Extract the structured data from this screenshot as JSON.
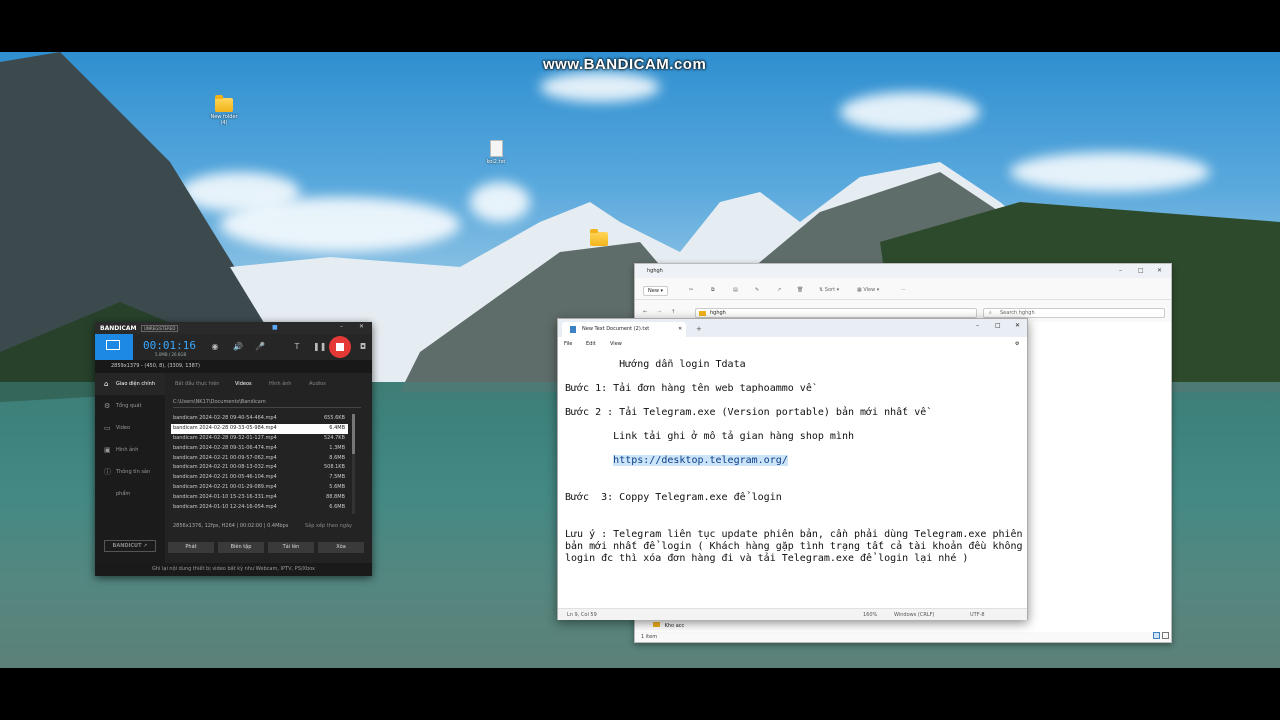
{
  "watermark": "www.BANDICAM.com",
  "desktop_icons": [
    {
      "label": "New folder\n(4)"
    },
    {
      "label": "koi2.txt"
    }
  ],
  "bandicam": {
    "logo": "BANDICAM",
    "unregistered": "UNREGISTERED",
    "timer": "00:01:16",
    "size": "5.0MB / 26.6GB",
    "resolution": "2859x1379 - (450, 8), (3309, 1387)",
    "sidebar": [
      {
        "label": "Giao diện chính",
        "icon": "home-icon"
      },
      {
        "label": "Tổng quát",
        "icon": "gear-icon"
      },
      {
        "label": "Video",
        "icon": "video-icon"
      },
      {
        "label": "Hình ảnh",
        "icon": "image-icon"
      },
      {
        "label": "Thông tin sản phẩm",
        "icon": "info-icon"
      }
    ],
    "bandicut_label": "BANDICUT ↗",
    "tabs": [
      "Bắt đầu thực hiện",
      "Videos",
      "Hình ảnh",
      "Audios"
    ],
    "path": "C:\\Users\\NK17\\Documents\\Bandicam",
    "files": [
      {
        "name": "bandicam 2024-02-28 09-40-54-464.mp4",
        "size": "655.6KB"
      },
      {
        "name": "bandicam 2024-02-28 09-33-05-984.mp4",
        "size": "6.4MB"
      },
      {
        "name": "bandicam 2024-02-28 09-32-01-127.mp4",
        "size": "524.7KB"
      },
      {
        "name": "bandicam 2024-02-28 09-31-06-474.mp4",
        "size": "1.3MB"
      },
      {
        "name": "bandicam 2024-02-21 00-09-57-062.mp4",
        "size": "8.6MB"
      },
      {
        "name": "bandicam 2024-02-21 00-08-13-032.mp4",
        "size": "508.1KB"
      },
      {
        "name": "bandicam 2024-02-21 00-05-46-104.mp4",
        "size": "7.5MB"
      },
      {
        "name": "bandicam 2024-02-21 00-01-29-089.mp4",
        "size": "5.6MB"
      },
      {
        "name": "bandicam 2024-01-10 15-23-16-331.mp4",
        "size": "88.8MB"
      },
      {
        "name": "bandicam 2024-01-10 12-24-16-054.mp4",
        "size": "6.6MB"
      }
    ],
    "info": "2856x1376, 12fps, H264 | 00:02:00 | 0.4Mbps",
    "sort_label": "Sắp xếp theo ngày",
    "buttons": [
      "Phát",
      "Biên tập",
      "Tải lên",
      "Xóa"
    ],
    "footer": "Ghi lại nội dung thiết bị video bất kỳ như Webcam, IPTV, PS/Xbox"
  },
  "explorer": {
    "title": "hghgh",
    "new_label": "New",
    "sort_label": "Sort",
    "view_label": "View",
    "address": "hghgh",
    "search_placeholder": "Search hghgh",
    "item_label": "Kho acc",
    "status": "1 item"
  },
  "notepad": {
    "tab_title": "New Text Document (2).txt",
    "menu": [
      "File",
      "Edit",
      "View"
    ],
    "lines": [
      "         Hướng dẫn login Tdata",
      "Bước 1: Tải đơn hàng tên web taphoammo về",
      "Bước 2 : Tải Telegram.exe (Version portable) bản mới nhất về",
      "        Link tải ghi ở mô tả gian hàng shop mình",
      "https://desktop.telegram.org/",
      "Bước  3: Coppy Telegram.exe để login",
      "Lưu ý : Telegram liên tục update phiên bản, cần phải dùng Telegram.exe phiên",
      "bản mới nhất để login ( Khách hàng gặp tình trạng tất cả tài khoản đều không",
      "login đc thì xóa đơn hàng đi và tải Telegram.exe để login lại nhé )"
    ],
    "status": {
      "position": "Ln 9, Col 59",
      "zoom": "160%",
      "line_ending": "Windows (CRLF)",
      "encoding": "UTF-8"
    }
  }
}
